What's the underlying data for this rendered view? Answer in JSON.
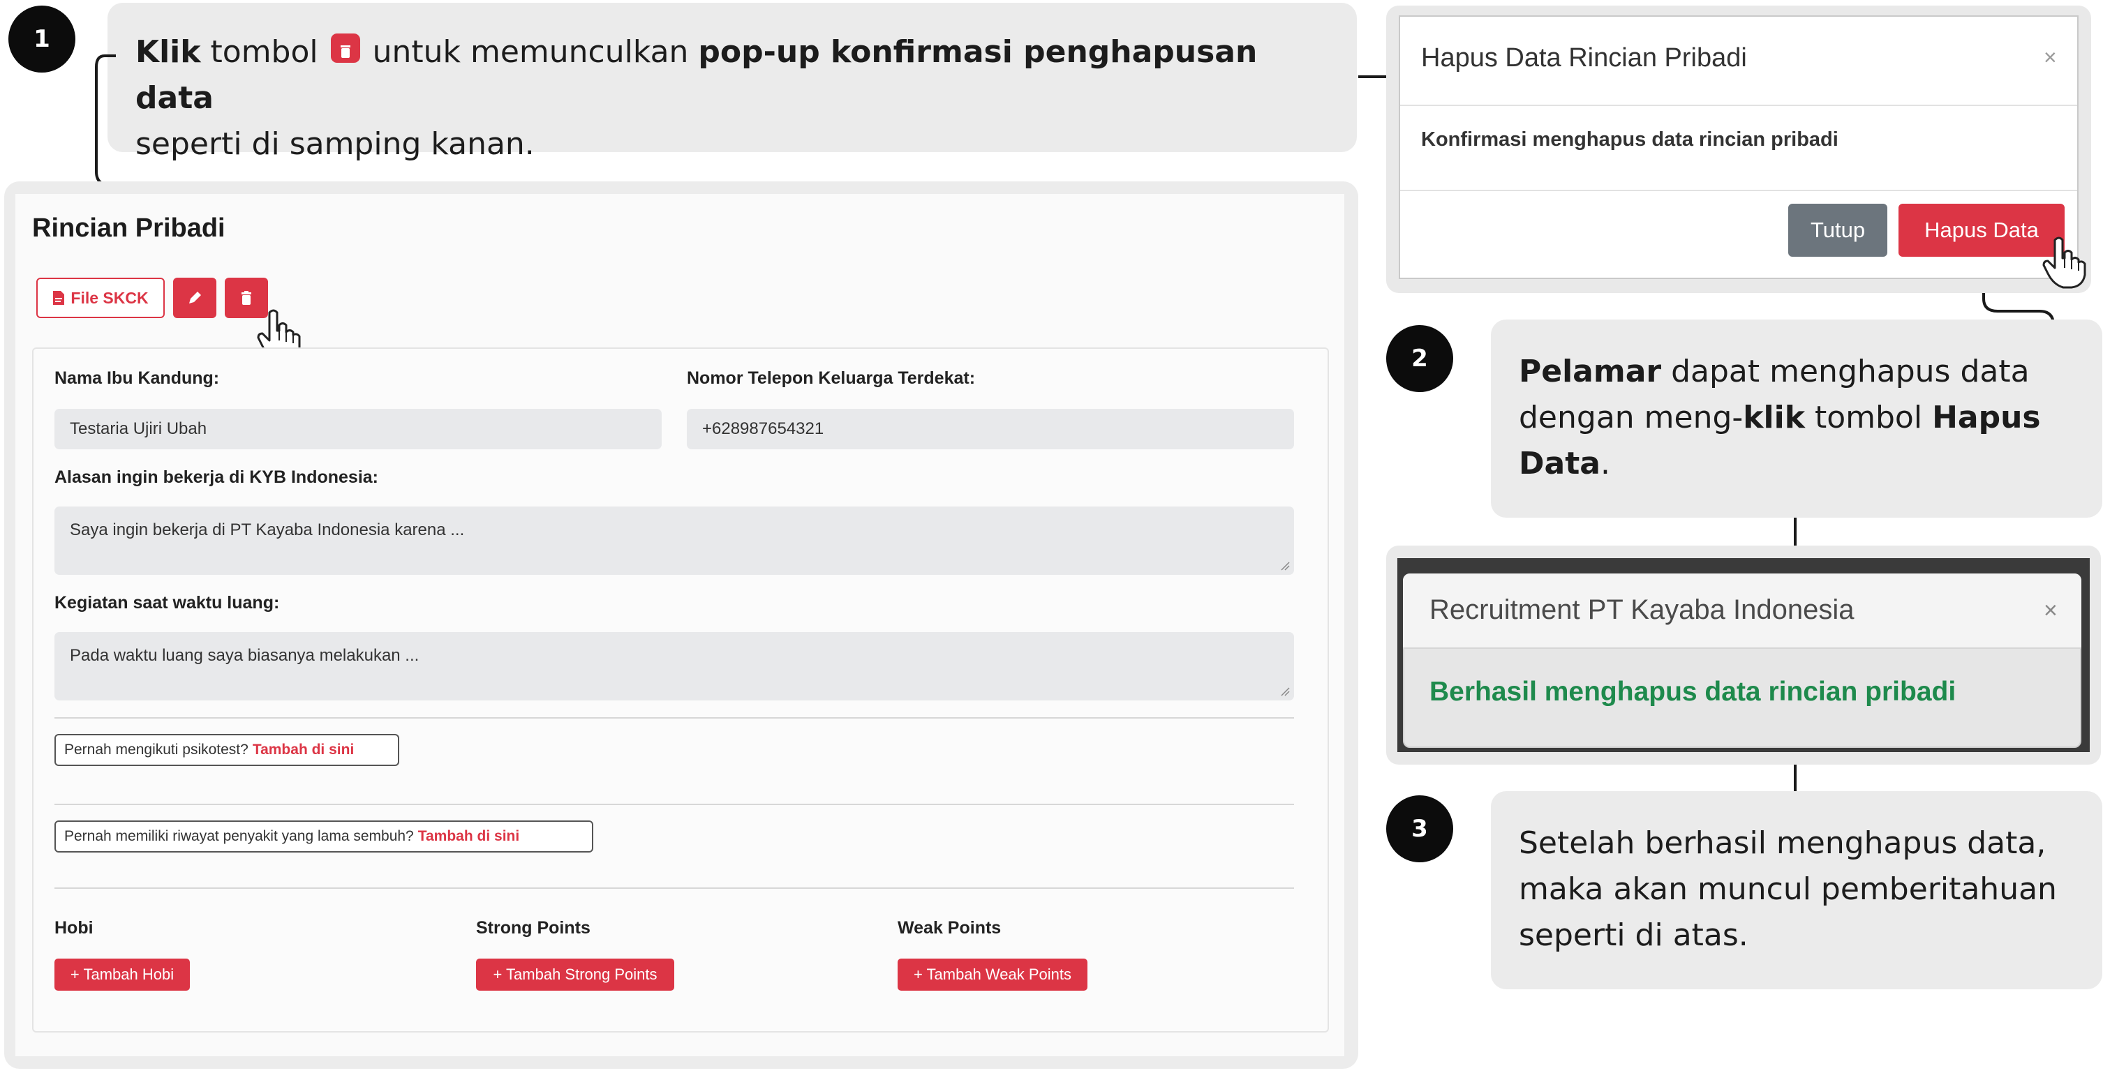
{
  "steps": [
    {
      "number": "1",
      "parts": [
        {
          "text": "Klik",
          "bold": true
        },
        {
          "text": " tombol ",
          "bold": false
        },
        {
          "icon": "trash-icon"
        },
        {
          "text": " untuk memunculkan ",
          "bold": false
        },
        {
          "text": "pop-up konfirmasi penghapusan data",
          "bold": true
        },
        {
          "text": " seperti di samping kanan.",
          "bold": false
        }
      ]
    },
    {
      "number": "2",
      "parts": [
        {
          "text": "Pelamar",
          "bold": true
        },
        {
          "text": " dapat menghapus data dengan meng-",
          "bold": false
        },
        {
          "text": "klik",
          "bold": true
        },
        {
          "text": " tombol ",
          "bold": false
        },
        {
          "text": "Hapus Data",
          "bold": true
        },
        {
          "text": ".",
          "bold": false
        }
      ]
    },
    {
      "number": "3",
      "parts": [
        {
          "text": "Setelah berhasil menghapus data, maka akan muncul pemberitahuan seperti di atas.",
          "bold": false
        }
      ]
    }
  ],
  "form": {
    "title": "Rincian Pribadi",
    "file_button_label": "File SKCK",
    "fields": {
      "nama_ibu": {
        "label": "Nama Ibu Kandung:",
        "value": "Testaria Ujiri Ubah"
      },
      "telepon": {
        "label": "Nomor Telepon Keluarga Terdekat:",
        "value": "+628987654321"
      },
      "alasan": {
        "label": "Alasan ingin bekerja di KYB Indonesia:",
        "value": "Saya ingin bekerja di PT Kayaba Indonesia karena ..."
      },
      "kegiatan": {
        "label": "Kegiatan saat waktu luang:",
        "value": "Pada waktu luang saya biasanya melakukan ..."
      }
    },
    "psikotest": {
      "question": "Pernah mengikuti psikotest?",
      "link": "Tambah di sini"
    },
    "penyakit": {
      "question": "Pernah memiliki riwayat penyakit yang lama sembuh?",
      "link": "Tambah di sini"
    },
    "sections": {
      "hobi": {
        "title": "Hobi",
        "button": "+ Tambah Hobi"
      },
      "strong": {
        "title": "Strong Points",
        "button": "+ Tambah Strong Points"
      },
      "weak": {
        "title": "Weak Points",
        "button": "+ Tambah Weak Points"
      }
    }
  },
  "confirm_modal": {
    "title": "Hapus Data Rincian Pribadi",
    "close": "×",
    "message": "Konfirmasi menghapus data rincian pribadi",
    "close_button": "Tutup",
    "delete_button": "Hapus Data"
  },
  "success_modal": {
    "title": "Recruitment PT Kayaba Indonesia",
    "close": "×",
    "message": "Berhasil menghapus data rincian pribadi"
  },
  "colors": {
    "danger": "#dc3545",
    "secondary": "#6c757d",
    "success": "#1e8a4c",
    "callout_bg": "#ebebeb"
  }
}
